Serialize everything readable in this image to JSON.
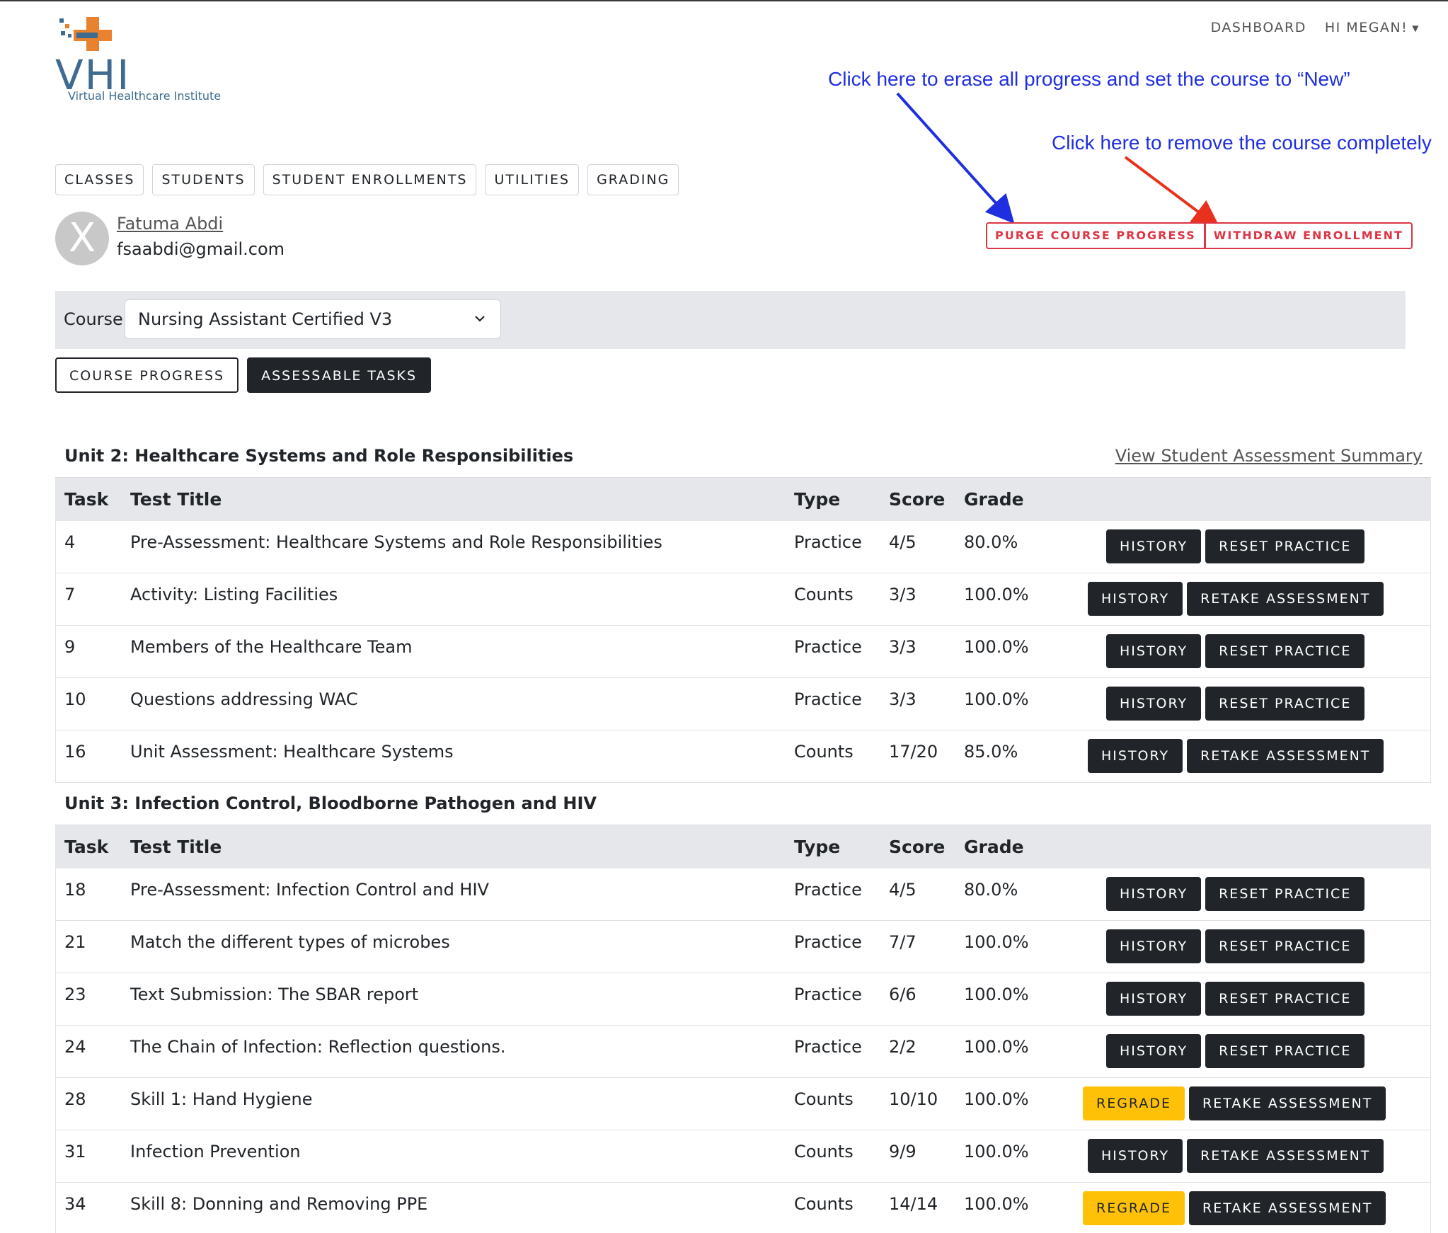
{
  "logo": {
    "letters": "VHI",
    "subtitle": "Virtual Healthcare Institute"
  },
  "topnav": {
    "dashboard": "DASHBOARD",
    "user": "HI MEGAN!"
  },
  "annotations": {
    "purge": "Click here to erase all progress and set the course to “New”",
    "withdraw": "Click here to remove the course completely"
  },
  "nav": [
    "CLASSES",
    "STUDENTS",
    "STUDENT ENROLLMENTS",
    "UTILITIES",
    "GRADING"
  ],
  "student": {
    "avatar_letter": "X",
    "name": "Fatuma Abdi",
    "email": "fsaabdi@gmail.com"
  },
  "actions": {
    "purge": "PURGE COURSE PROGRESS",
    "withdraw": "WITHDRAW ENROLLMENT"
  },
  "course": {
    "label": "Course",
    "selected": "Nursing Assistant Certified V3"
  },
  "tabs": {
    "progress": "COURSE PROGRESS",
    "tasks": "ASSESSABLE TASKS"
  },
  "summary_link": "View Student Assessment Summary",
  "headers": {
    "task": "Task",
    "title": "Test Title",
    "type": "Type",
    "score": "Score",
    "grade": "Grade"
  },
  "colors": {
    "dark": "#212529",
    "warning": "#ffc107",
    "danger": "#dc3545",
    "annotation_blue": "#1f2fe0",
    "arrow_red": "#e8321e"
  },
  "units": [
    {
      "title": "Unit 2: Healthcare Systems and Role Responsibilities",
      "rows": [
        {
          "task": "4",
          "title": "Pre-Assessment: Healthcare Systems and Role Responsibilities",
          "type": "Practice",
          "score": "4/5",
          "grade": "80.0%",
          "btn1": "HISTORY",
          "btn2": "RESET PRACTICE"
        },
        {
          "task": "7",
          "title": "Activity: Listing Facilities",
          "type": "Counts",
          "score": "3/3",
          "grade": "100.0%",
          "btn1": "HISTORY",
          "btn2": "RETAKE ASSESSMENT"
        },
        {
          "task": "9",
          "title": "Members of the Healthcare Team",
          "type": "Practice",
          "score": "3/3",
          "grade": "100.0%",
          "btn1": "HISTORY",
          "btn2": "RESET PRACTICE"
        },
        {
          "task": "10",
          "title": "Questions addressing WAC",
          "type": "Practice",
          "score": "3/3",
          "grade": "100.0%",
          "btn1": "HISTORY",
          "btn2": "RESET PRACTICE"
        },
        {
          "task": "16",
          "title": "Unit Assessment: Healthcare Systems",
          "type": "Counts",
          "score": "17/20",
          "grade": "85.0%",
          "btn1": "HISTORY",
          "btn2": "RETAKE ASSESSMENT"
        }
      ]
    },
    {
      "title": "Unit 3: Infection Control, Bloodborne Pathogen and HIV",
      "rows": [
        {
          "task": "18",
          "title": "Pre-Assessment: Infection Control and HIV",
          "type": "Practice",
          "score": "4/5",
          "grade": "80.0%",
          "btn1": "HISTORY",
          "btn2": "RESET PRACTICE"
        },
        {
          "task": "21",
          "title": "Match the different types of microbes",
          "type": "Practice",
          "score": "7/7",
          "grade": "100.0%",
          "btn1": "HISTORY",
          "btn2": "RESET PRACTICE"
        },
        {
          "task": "23",
          "title": "Text Submission: The SBAR report",
          "type": "Practice",
          "score": "6/6",
          "grade": "100.0%",
          "btn1": "HISTORY",
          "btn2": "RESET PRACTICE"
        },
        {
          "task": "24",
          "title": "The Chain of Infection: Reflection questions.",
          "type": "Practice",
          "score": "2/2",
          "grade": "100.0%",
          "btn1": "HISTORY",
          "btn2": "RESET PRACTICE"
        },
        {
          "task": "28",
          "title": "Skill 1: Hand Hygiene",
          "type": "Counts",
          "score": "10/10",
          "grade": "100.0%",
          "btn1": "REGRADE",
          "btn2": "RETAKE ASSESSMENT"
        },
        {
          "task": "31",
          "title": "Infection Prevention",
          "type": "Counts",
          "score": "9/9",
          "grade": "100.0%",
          "btn1": "HISTORY",
          "btn2": "RETAKE ASSESSMENT"
        },
        {
          "task": "34",
          "title": "Skill 8: Donning and Removing PPE",
          "type": "Counts",
          "score": "14/14",
          "grade": "100.0%",
          "btn1": "REGRADE",
          "btn2": "RETAKE ASSESSMENT"
        }
      ]
    }
  ]
}
